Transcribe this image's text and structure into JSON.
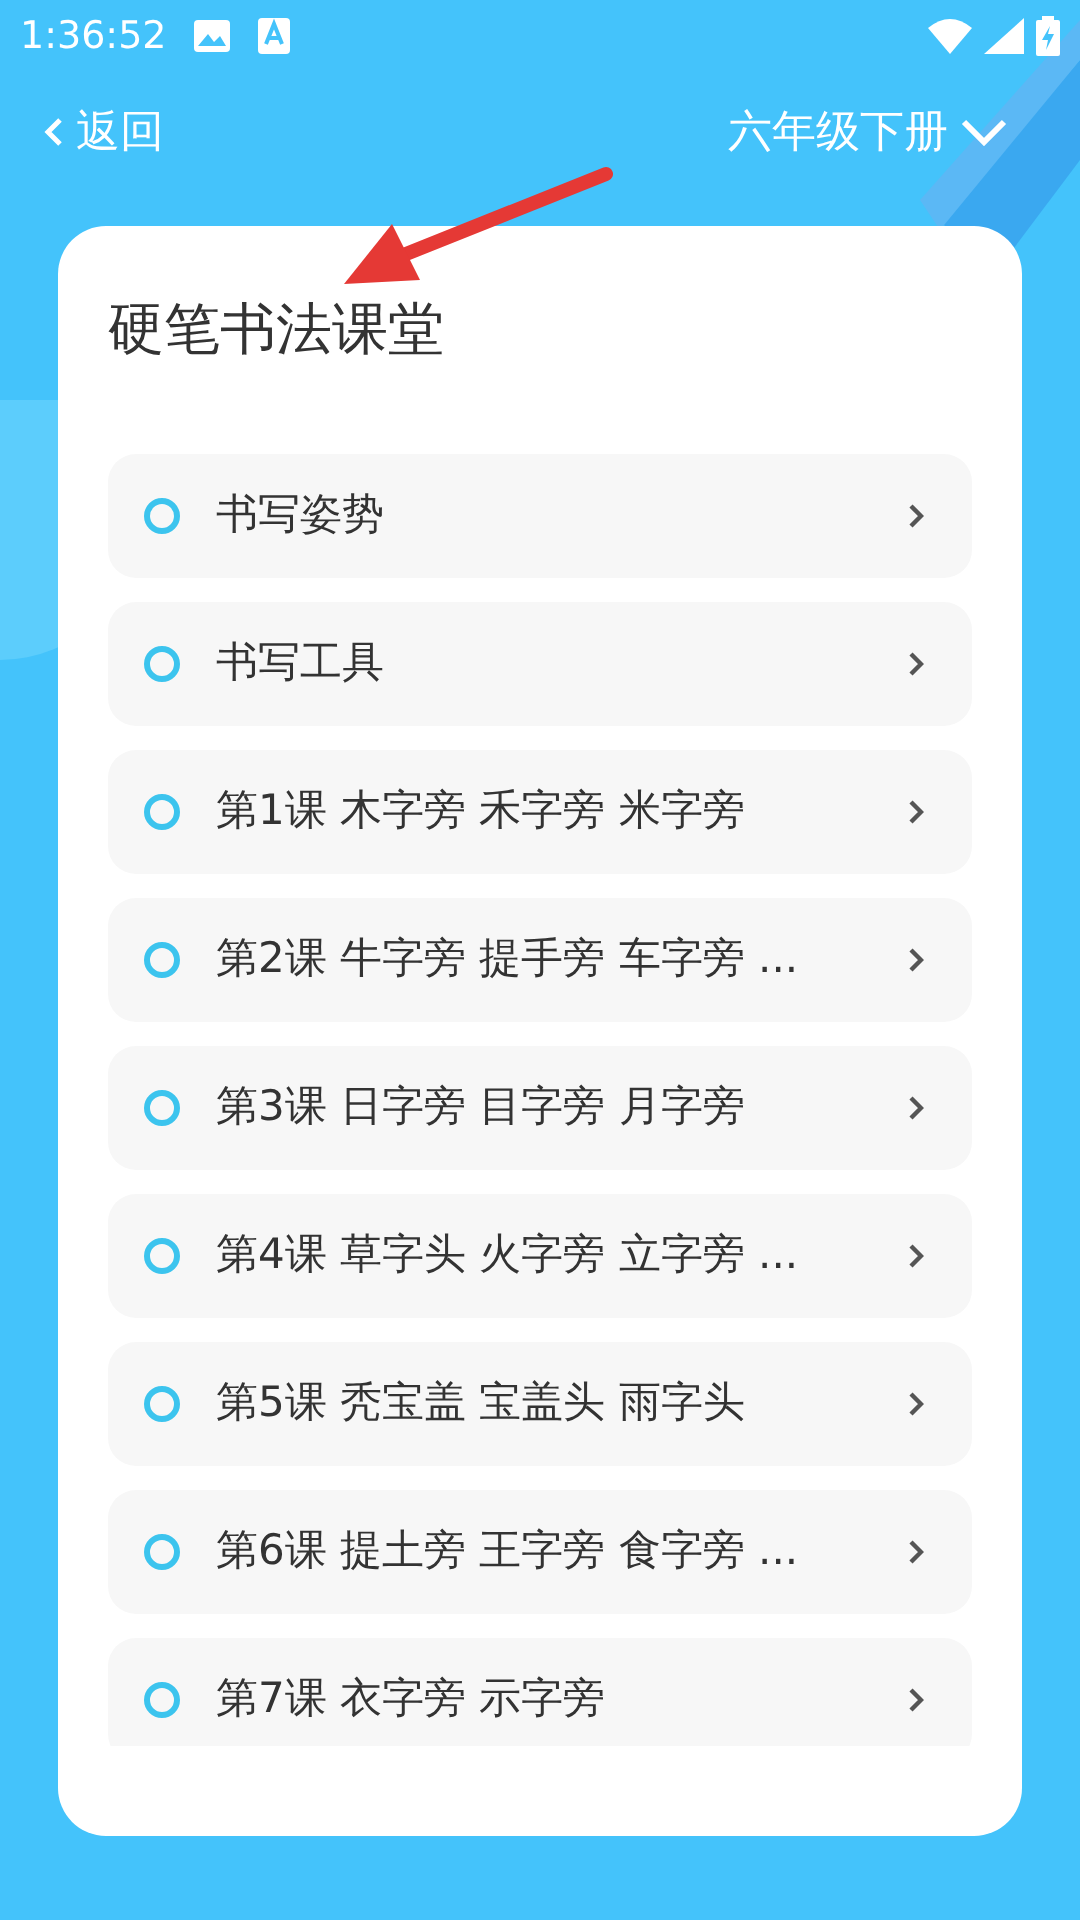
{
  "status_bar": {
    "time": "1:36:52"
  },
  "header": {
    "back": "返回",
    "grade": "六年级下册"
  },
  "card": {
    "title": "硬笔书法课堂",
    "items": [
      {
        "label": "书写姿势"
      },
      {
        "label": "书写工具"
      },
      {
        "label": "第1课 木字旁 禾字旁 米字旁"
      },
      {
        "label": "第2课 牛字旁 提手旁 车字旁 ..."
      },
      {
        "label": "第3课 日字旁 目字旁 月字旁"
      },
      {
        "label": "第4课 草字头 火字旁 立字旁 ..."
      },
      {
        "label": "第5课 秃宝盖 宝盖头 雨字头"
      },
      {
        "label": "第6课 提土旁 王字旁 食字旁 ..."
      },
      {
        "label": "第7课 衣字旁 示字旁"
      }
    ]
  }
}
